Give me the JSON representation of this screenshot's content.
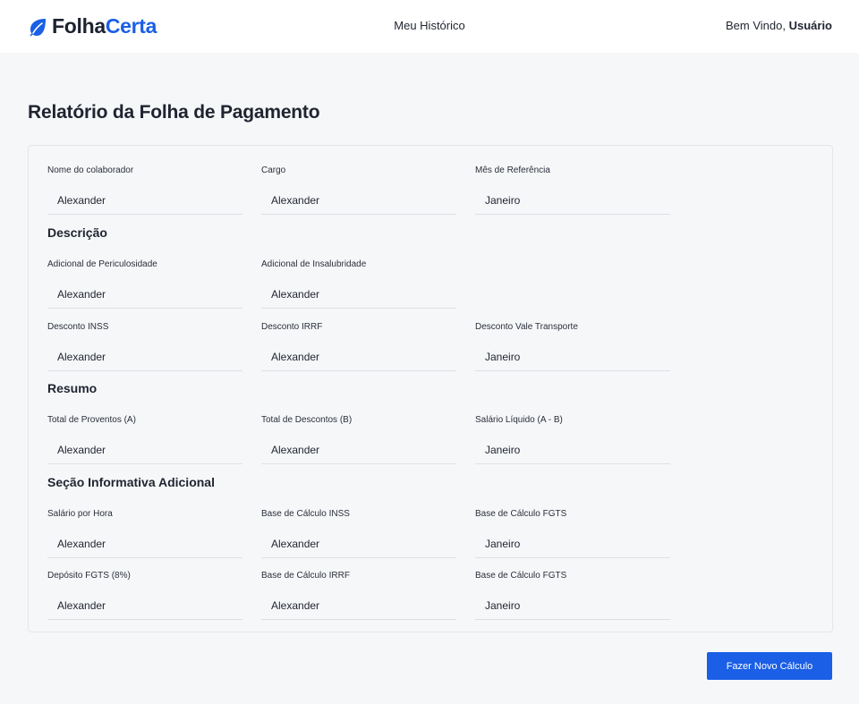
{
  "header": {
    "logo_part1": "Folha",
    "logo_part2": "Certa",
    "nav_history": "Meu Histórico",
    "greeting_prefix": "Bem Vindo, ",
    "greeting_user": "Usuário",
    "brand_color": "#1a5fe5",
    "logo_icon": "leaf-icon"
  },
  "page": {
    "title": "Relatório da Folha de Pagamento"
  },
  "form": {
    "header_fields": [
      {
        "label": "Nome do colaborador",
        "value": "Alexander"
      },
      {
        "label": "Cargo",
        "value": "Alexander"
      },
      {
        "label": "Mês de Referência",
        "value": "Janeiro"
      }
    ],
    "descricao": {
      "title": "Descrição",
      "row1": [
        {
          "label": "Adicional de Periculosidade",
          "value": "Alexander"
        },
        {
          "label": "Adicional de Insalubridade",
          "value": "Alexander"
        }
      ],
      "row2": [
        {
          "label": "Desconto INSS",
          "value": "Alexander"
        },
        {
          "label": "Desconto IRRF",
          "value": "Alexander"
        },
        {
          "label": "Desconto Vale Transporte",
          "value": "Janeiro"
        }
      ]
    },
    "resumo": {
      "title": "Resumo",
      "row1": [
        {
          "label": "Total de Proventos (A)",
          "value": "Alexander"
        },
        {
          "label": "Total de Descontos (B)",
          "value": "Alexander"
        },
        {
          "label": "Salário Líquido (A - B)",
          "value": "Janeiro"
        }
      ]
    },
    "adicional": {
      "title": "Seção Informativa Adicional",
      "row1": [
        {
          "label": "Salário por Hora",
          "value": "Alexander"
        },
        {
          "label": "Base de Cálculo INSS",
          "value": "Alexander"
        },
        {
          "label": "Base de Cálculo FGTS",
          "value": "Janeiro"
        }
      ],
      "row2": [
        {
          "label": "Depósito FGTS (8%)",
          "value": "Alexander"
        },
        {
          "label": "Base de Cálculo IRRF",
          "value": "Alexander"
        },
        {
          "label": "Base de Cálculo FGTS",
          "value": "Janeiro"
        }
      ]
    }
  },
  "actions": {
    "new_calc_label": "Fazer Novo Cálculo"
  }
}
